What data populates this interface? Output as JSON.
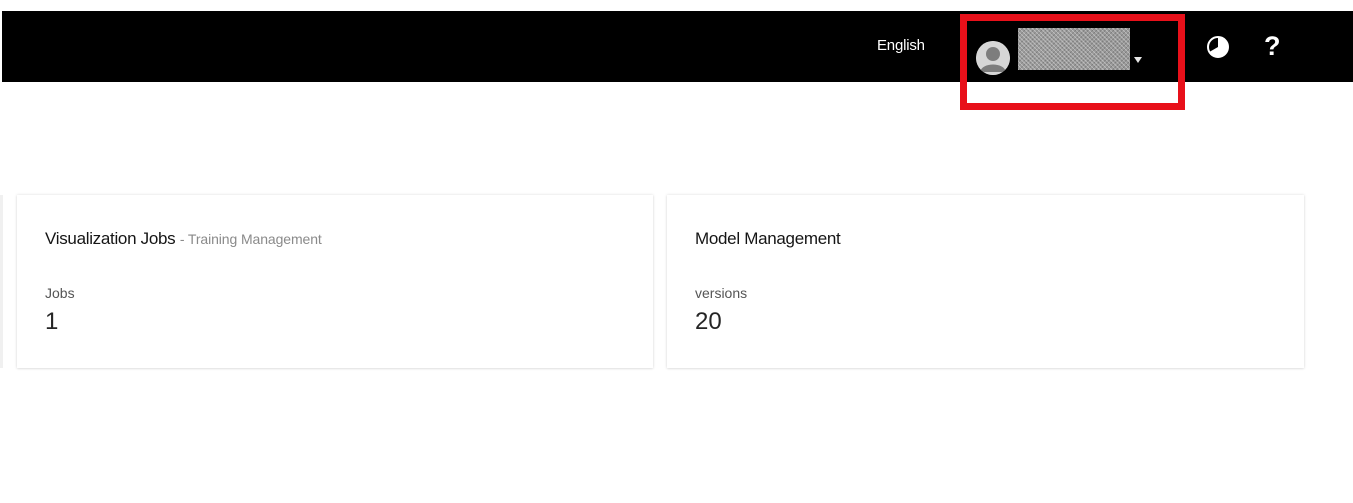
{
  "header": {
    "language": "English",
    "user_menu": {
      "avatar_icon": "user-avatar-icon",
      "username": "",
      "dropdown_icon": "caret-down-icon"
    },
    "theme_icon": "contrast-icon",
    "help_label": "?"
  },
  "cards": [
    {
      "title": "Visualization Jobs",
      "subtitle": "- Training Management",
      "metric_label": "Jobs",
      "metric_value": "1"
    },
    {
      "title": "Model Management",
      "subtitle": "",
      "metric_label": "versions",
      "metric_value": "20"
    }
  ],
  "colors": {
    "header_bg": "#000000",
    "highlight_border": "#e8101a",
    "card_bg": "#ffffff",
    "subtitle_text": "#8a8a8a"
  }
}
